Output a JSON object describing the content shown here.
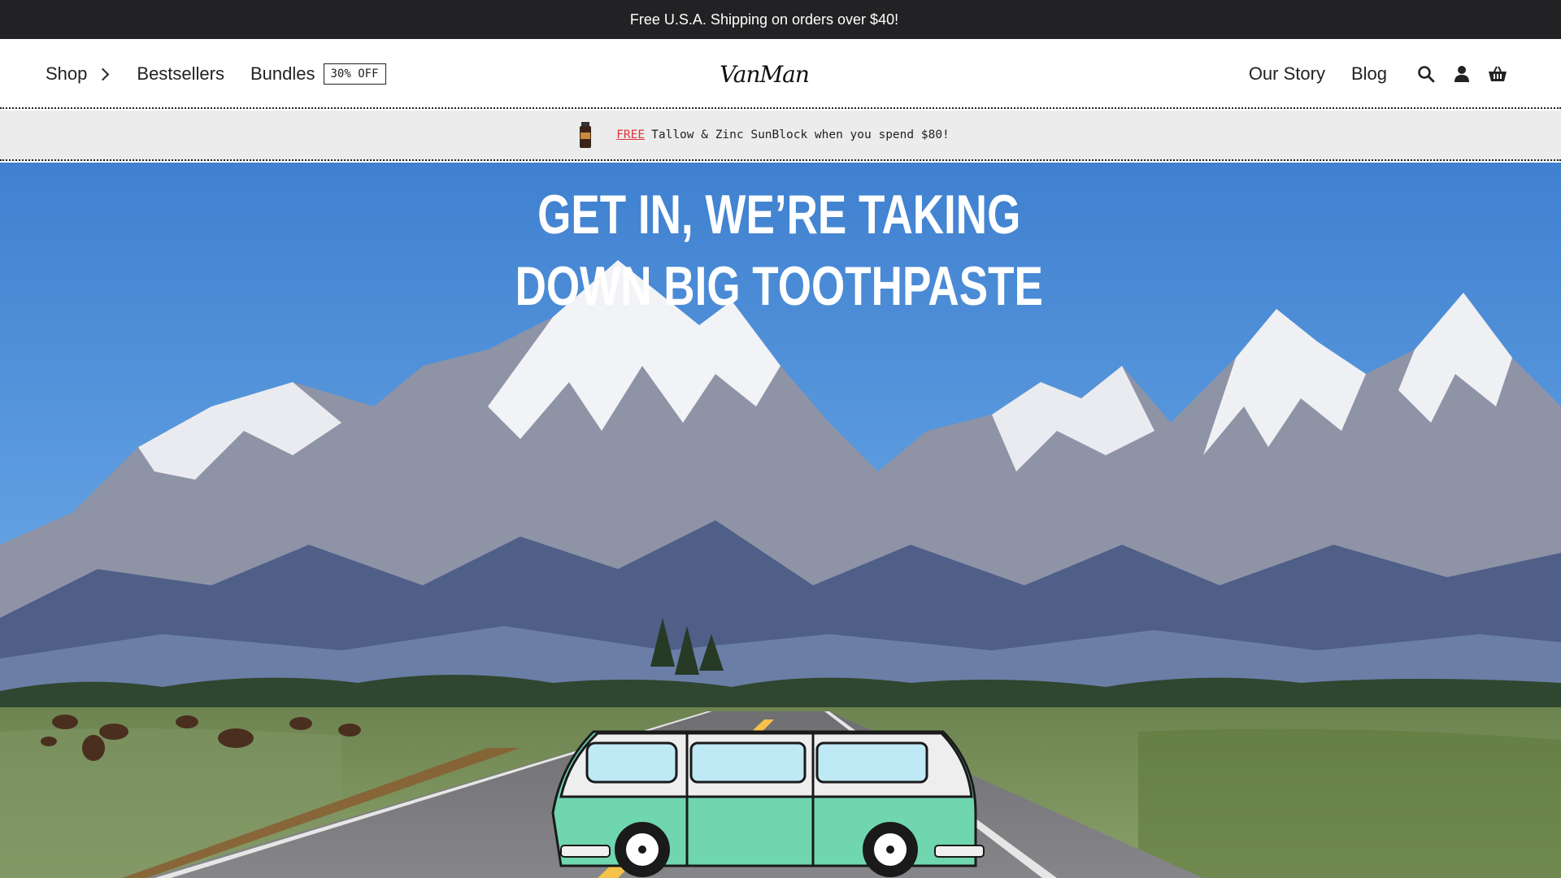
{
  "announcement": {
    "text": "Free U.S.A. Shipping on orders over $40!"
  },
  "header": {
    "brand": "VanMan",
    "left_nav": [
      {
        "label": "Shop"
      },
      {
        "label": "Bestsellers"
      },
      {
        "label": "Bundles",
        "badge": "30% OFF"
      }
    ],
    "right_nav": [
      {
        "label": "Our Story"
      },
      {
        "label": "Blog"
      }
    ],
    "icons": [
      "search-icon",
      "account-icon",
      "cart-basket-icon"
    ]
  },
  "promo": {
    "free_label": "FREE",
    "text": "Tallow & Zinc SunBlock when you spend $80!",
    "link_color": "#e0343a"
  },
  "hero": {
    "headline_line1": "GET IN, WE’RE TAKING",
    "headline_line2": "DOWN BIG TOOTHPASTE",
    "sky_color": "#4f8fd6",
    "van_color": "#6fd6b0"
  }
}
